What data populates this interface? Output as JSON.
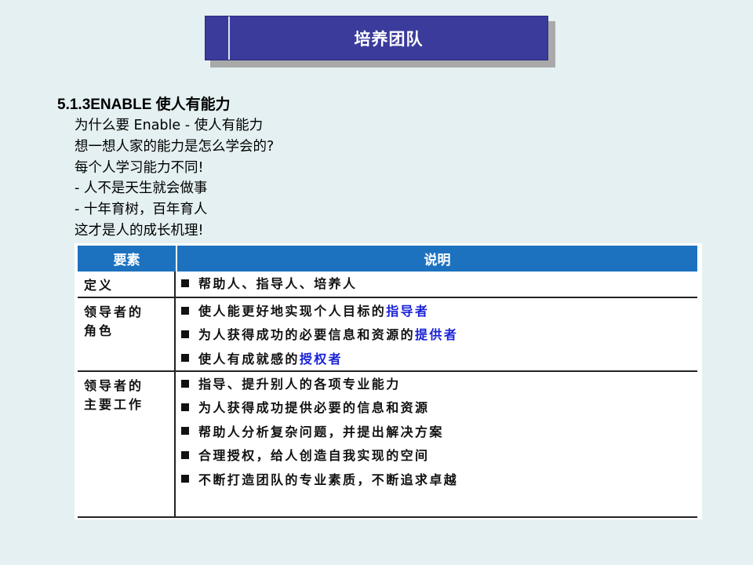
{
  "banner": {
    "title": "培养团队"
  },
  "section": {
    "heading": "5.1.3ENABLE 使人有能力",
    "lines": [
      "为什么要 Enable - 使人有能力",
      "想一想人家的能力是怎么学会的?",
      "每个人学习能力不同!",
      " - 人不是天生就会做事",
      " - 十年育树，百年育人",
      "这才是人的成长机理!"
    ]
  },
  "table": {
    "headers": [
      "要素",
      "说明"
    ],
    "rows": [
      {
        "label": "定义",
        "items": [
          {
            "text": "帮助人、指导人、培养人",
            "highlight": ""
          }
        ]
      },
      {
        "label": "领导者的角色",
        "label_lines": [
          "领导者的",
          "角色"
        ],
        "items": [
          {
            "text": "使人能更好地实现个人目标的",
            "highlight": "指导者"
          },
          {
            "text": "为人获得成功的必要信息和资源的",
            "highlight": "提供者"
          },
          {
            "text": "使人有成就感的",
            "highlight": "授权者"
          }
        ]
      },
      {
        "label": "领导者的主要工作",
        "label_lines": [
          "领导者的",
          "主要工作"
        ],
        "items": [
          {
            "text": "指导、提升别人的各项专业能力",
            "highlight": ""
          },
          {
            "text": "为人获得成功提供必要的信息和资源",
            "highlight": ""
          },
          {
            "text": "帮助人分析复杂问题，并提出解决方案",
            "highlight": ""
          },
          {
            "text": "合理授权，给人创造自我实现的空间",
            "highlight": ""
          },
          {
            "text": "不断打造团队的专业素质，不断追求卓越",
            "highlight": ""
          }
        ]
      }
    ]
  },
  "colors": {
    "background": "#e4f0f1",
    "banner": "#3b3b9c",
    "table_header": "#1d72c0",
    "highlight": "#1a22d8"
  }
}
